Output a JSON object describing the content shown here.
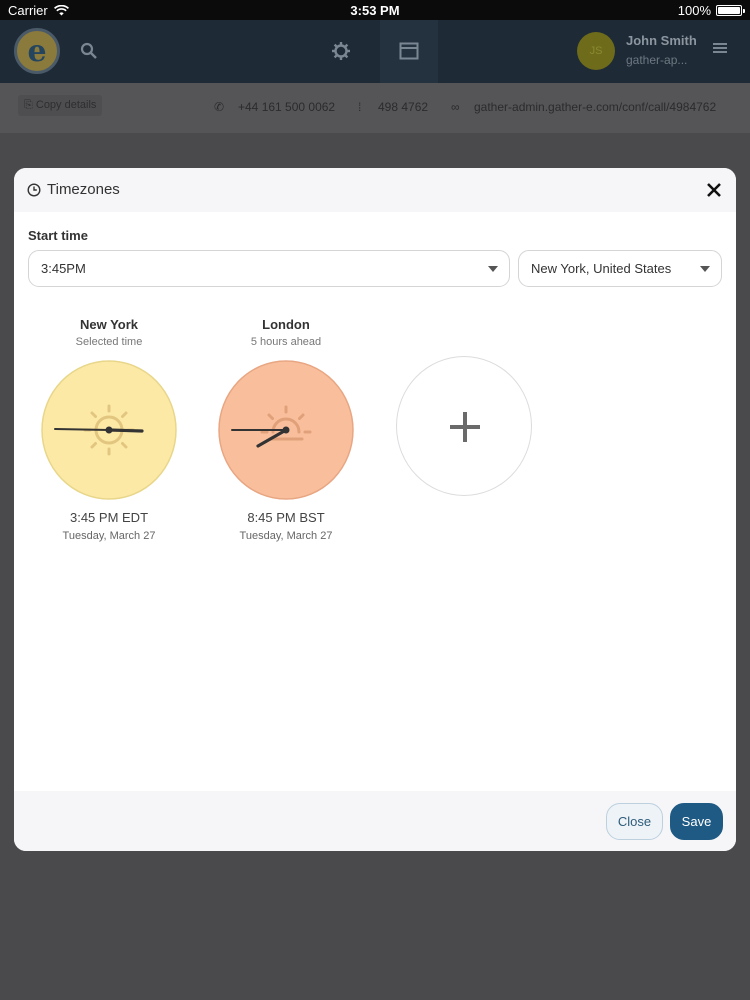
{
  "status_bar": {
    "carrier": "Carrier",
    "time": "3:53 PM",
    "battery": "100%",
    "battery_level": 1.0
  },
  "app_header": {
    "logo_letter": "e",
    "user": {
      "initials": "JS",
      "name": "John Smith",
      "subtitle": "gather-ap..."
    }
  },
  "info_bar": {
    "copy_details": "Copy details",
    "phone": "+44 161 500 0062",
    "pin": "498 4762",
    "url": "gather-admin.gather-e.com/conf/call/4984762"
  },
  "modal": {
    "title": "Timezones",
    "start_time_label": "Start time",
    "start_time_value": "3:45PM",
    "timezone_value": "New York, United States",
    "clocks": [
      {
        "city": "New York",
        "subtitle": "Selected time",
        "time": "3:45 PM EDT",
        "date": "Tuesday, March 27",
        "face_color": "#fce9a6",
        "border_color": "#e8d68a",
        "icon": "sun-icon"
      },
      {
        "city": "London",
        "subtitle": "5 hours ahead",
        "time": "8:45 PM BST",
        "date": "Tuesday, March 27",
        "face_color": "#f9bf9c",
        "border_color": "#e8a683",
        "icon": "sunset-icon"
      }
    ],
    "add_icon": "plus-icon",
    "close_button": "Close",
    "save_button": "Save"
  },
  "colors": {
    "primary": "#1f5a84",
    "overlay": "#4a4a4c"
  }
}
